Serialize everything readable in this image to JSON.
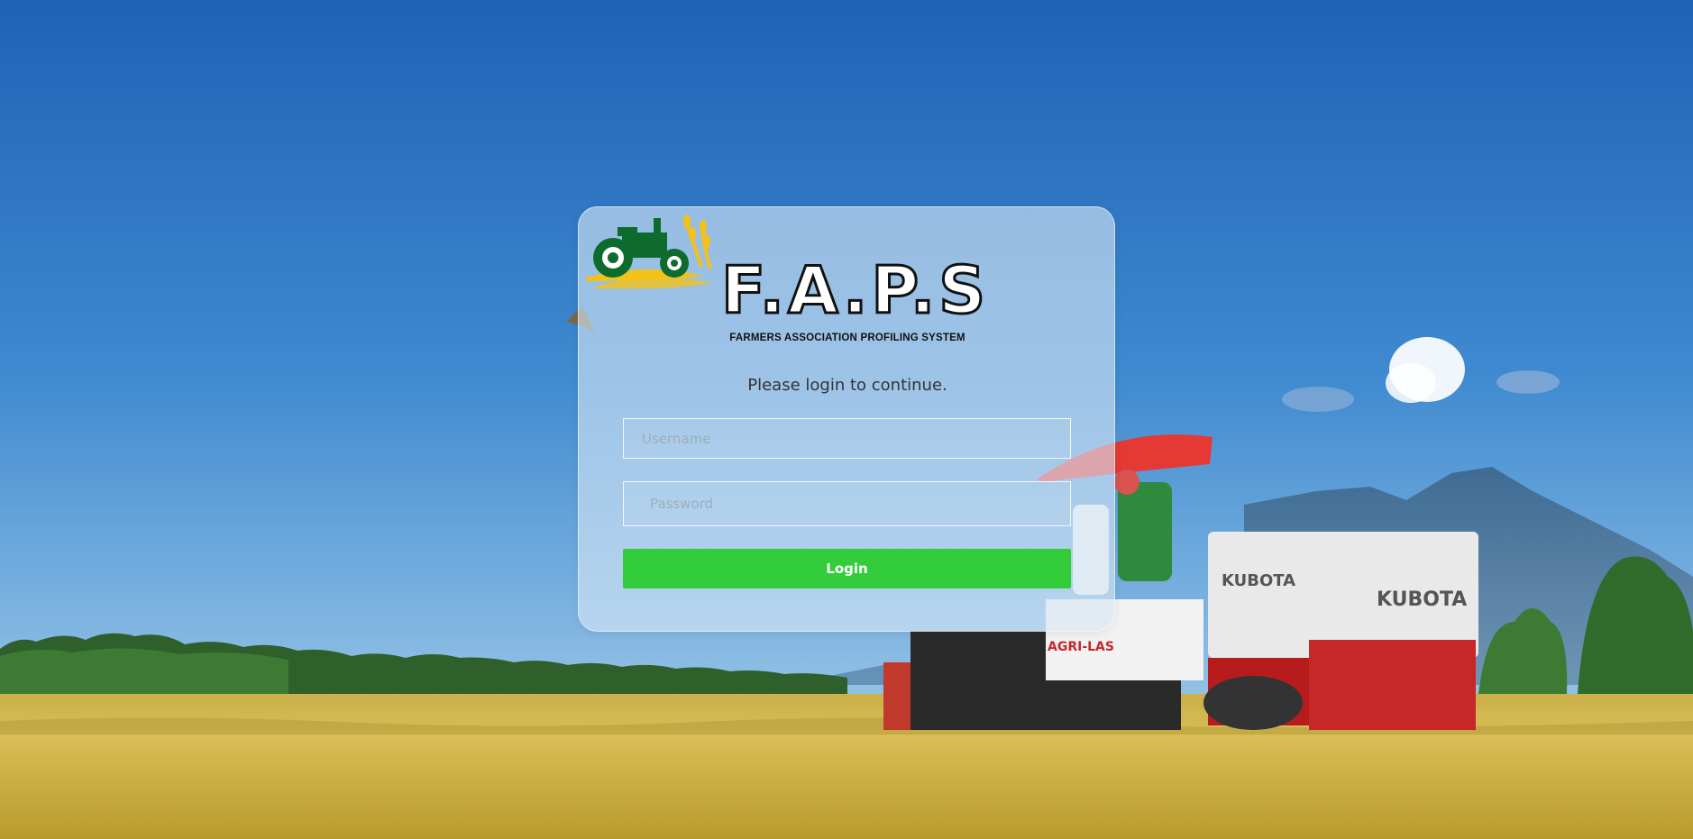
{
  "logo": {
    "title": "F.A.P.S",
    "subtitle": "FARMERS ASSOCIATION PROFILING SYSTEM",
    "icon": "tractor-wheat-icon"
  },
  "login": {
    "prompt": "Please login to continue.",
    "username_placeholder": "Username",
    "username_value": "",
    "password_placeholder": "Password",
    "password_value": "",
    "button_label": "Login"
  },
  "background": {
    "harvester_brand": "KUBOTA",
    "harvester_side_text": "AGRI-LAS"
  },
  "colors": {
    "login_button": "#33cc3a",
    "logo_tractor": "#0e6b2e",
    "logo_wheat": "#f2c21a",
    "sky_top": "#1f66b8",
    "field": "#d8b94a"
  }
}
